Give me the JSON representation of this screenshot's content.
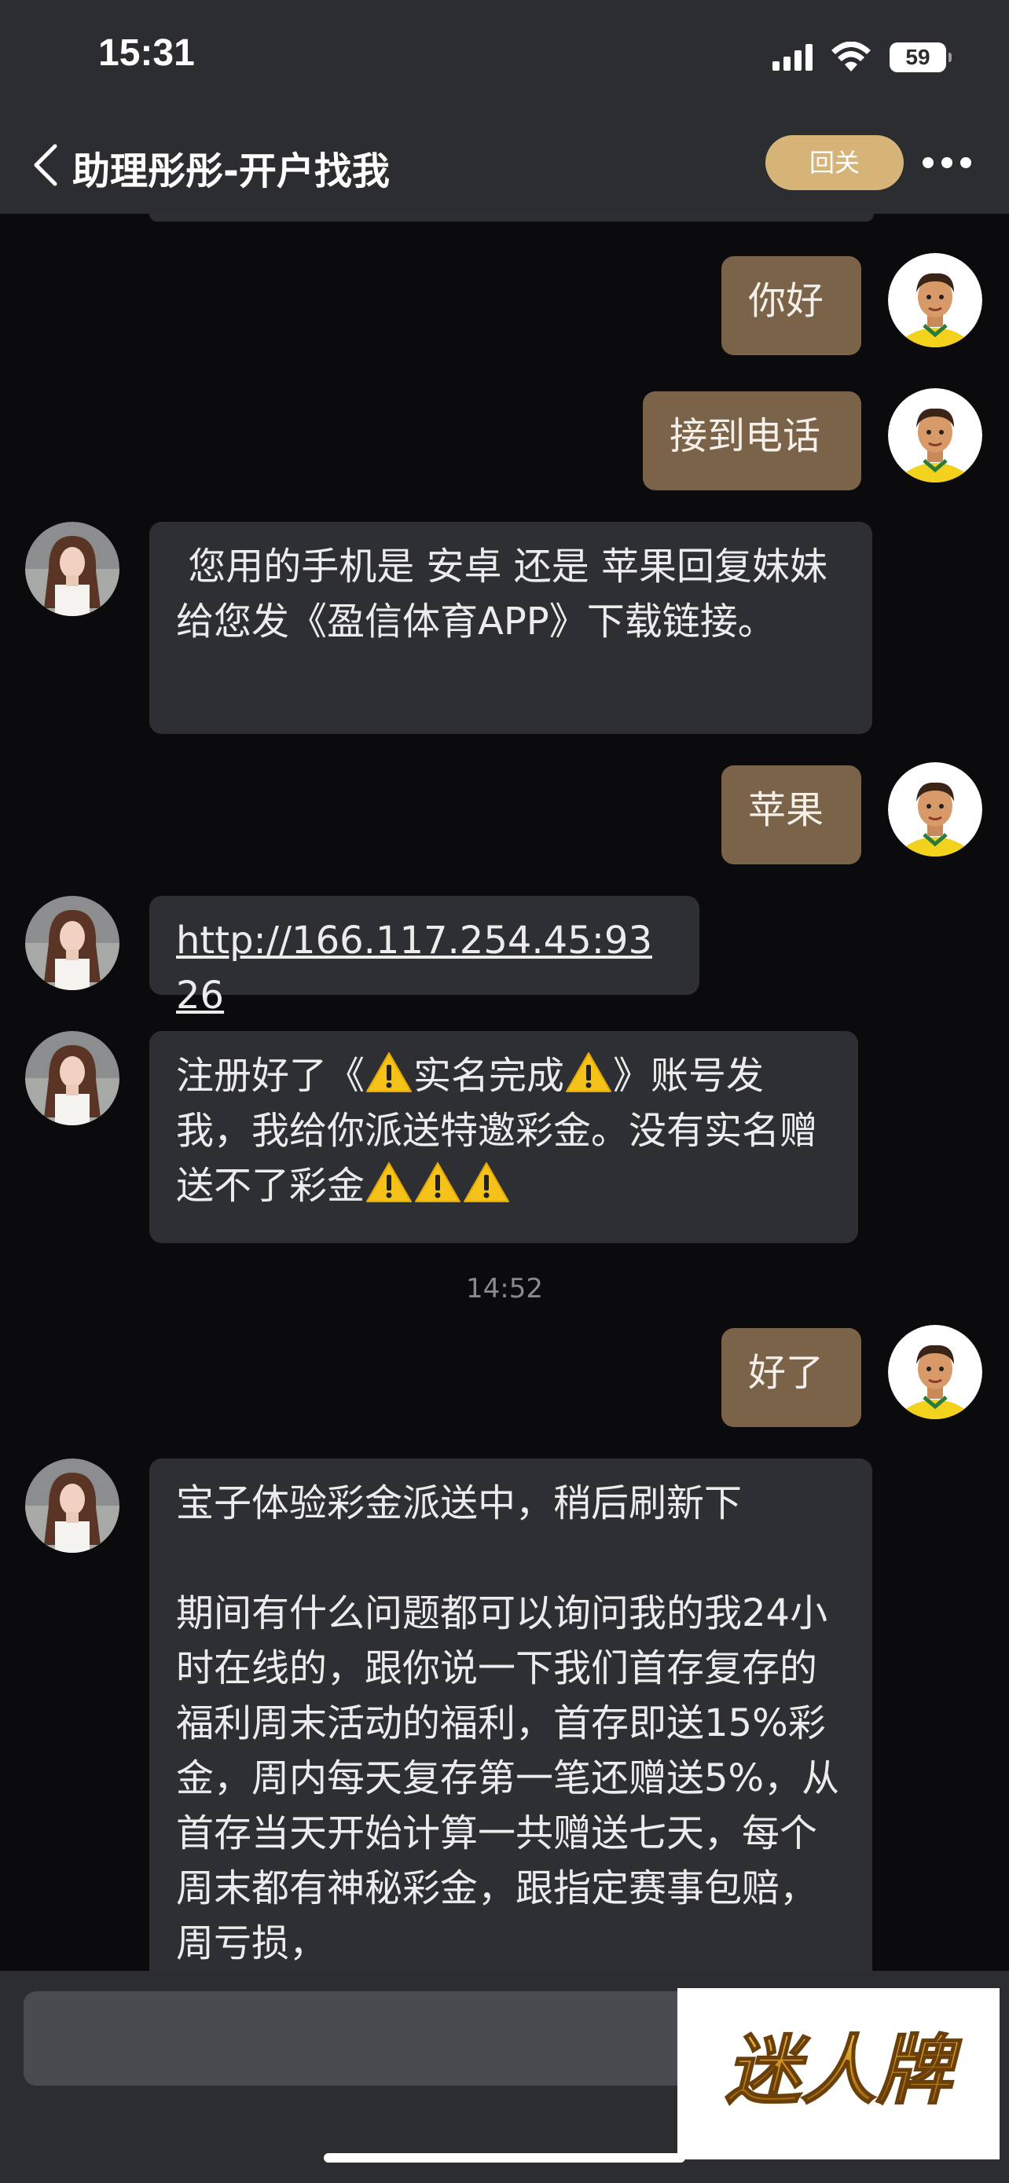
{
  "status_bar": {
    "time": "15:31",
    "battery": "59"
  },
  "header": {
    "back_icon": "chevron-left-icon",
    "title": "助理彤彤-开户找我",
    "follow_label": "回关",
    "more_icon": "more-dots-icon"
  },
  "messages": [
    {
      "side": "out",
      "text": "你好"
    },
    {
      "side": "out",
      "text": "接到电话"
    },
    {
      "side": "in",
      "text": " 您用的手机是 安卓 还是 苹果回复妹妹给您发《盈信体育APP》下载链接。"
    },
    {
      "side": "out",
      "text": "苹果"
    },
    {
      "side": "in",
      "text": "http://166.117.254.45:9326"
    },
    {
      "side": "in",
      "parts": [
        "注册好了《",
        "》账号发我，我给你派送特邀彩金。没有实名赠送不了彩金"
      ],
      "inner": "实名完成"
    },
    {
      "timestamp": "14:52"
    },
    {
      "side": "out",
      "text": "好了"
    },
    {
      "side": "in",
      "line1": "宝子体验彩金派送中，稍后刷新下",
      "line2": "期间有什么问题都可以询问我的我24小时在线的，跟你说一下我们首存复存的福利周末活动的福利，首存即送15%彩金，周内每天复存第一笔还赠送5%，从首存当天开始计算一共赠送七天，每个周末都有神秘彩金，跟指定赛事包赔，周亏损，"
    }
  ],
  "watermark": {
    "text": "迷人牌"
  },
  "colors": {
    "bar": "#2c2d31",
    "out_bubble": "#7a6349",
    "in_bubble": "#2e2f33",
    "follow": "#d6b477"
  }
}
